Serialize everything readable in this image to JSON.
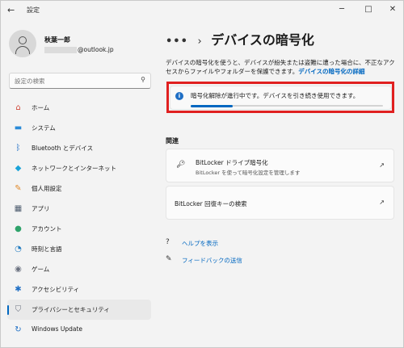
{
  "window": {
    "back_icon": "arrow-left-icon",
    "title": "設定",
    "minimize": "─",
    "maximize": "□",
    "close": "✕"
  },
  "profile": {
    "name": "秋葉一郎",
    "email_suffix": "@outlook.jp"
  },
  "search": {
    "placeholder": "設定の検索",
    "icon": "🔍"
  },
  "nav": {
    "items": [
      {
        "label": "ホーム",
        "icon": "⌂",
        "color": "#d14a3c"
      },
      {
        "label": "システム",
        "icon": "▬",
        "color": "#2a8ad8"
      },
      {
        "label": "Bluetooth とデバイス",
        "icon": "ᛒ",
        "color": "#1f6fc5"
      },
      {
        "label": "ネットワークとインターネット",
        "icon": "◆",
        "color": "#1aa3d9"
      },
      {
        "label": "個人用設定",
        "icon": "✎",
        "color": "#e08a2c"
      },
      {
        "label": "アプリ",
        "icon": "▦",
        "color": "#4d5c6e"
      },
      {
        "label": "アカウント",
        "icon": "●",
        "color": "#2fa36b"
      },
      {
        "label": "時刻と言語",
        "icon": "◔",
        "color": "#1f7ac0"
      },
      {
        "label": "ゲーム",
        "icon": "◉",
        "color": "#6b7280"
      },
      {
        "label": "アクセシビリティ",
        "icon": "✱",
        "color": "#1f6fc5"
      },
      {
        "label": "プライバシーとセキュリティ",
        "icon": "⛉",
        "color": "#6b7280"
      },
      {
        "label": "Windows Update",
        "icon": "↻",
        "color": "#1f6fc5"
      }
    ],
    "active_index": 10
  },
  "page": {
    "breadcrumb_more": "•••",
    "breadcrumb_sep": "›",
    "title": "デバイスの暗号化",
    "description": "デバイスの暗号化を使うと、デバイスが紛失または盗難に遭った場合に、不正なアクセスからファイルやフォルダーを保護できます。",
    "description_link": "デバイスの暗号化の詳細"
  },
  "status": {
    "text": "暗号化解除が進行中です。デバイスを引き続き使用できます。",
    "progress": 0.22
  },
  "related": {
    "label": "関連",
    "bitlocker": {
      "title": "BitLocker ドライブ暗号化",
      "subtitle": "BitLocker を使って暗号化設定を管理します"
    },
    "recovery": {
      "title": "BitLocker 回復キーの検索"
    }
  },
  "links": {
    "help": "ヘルプを表示",
    "feedback": "フィードバックの送信"
  }
}
